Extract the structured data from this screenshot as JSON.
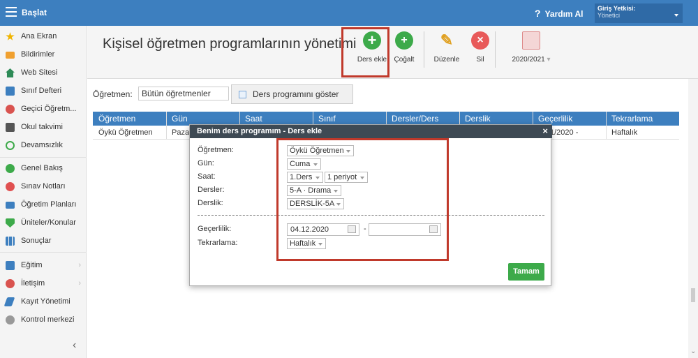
{
  "app": {
    "title": "Başlat"
  },
  "top": {
    "help_label": "Yardım Al",
    "help_icon": "question-icon",
    "login_label": "Giriş Yetkisi:",
    "login_role": "Yönetici"
  },
  "sidebar": {
    "items": [
      {
        "label": "Ana Ekran",
        "icon": "star-icon",
        "color": "#f0b400"
      },
      {
        "label": "Bildirimler",
        "icon": "envelope-icon",
        "color": "#f0a030"
      },
      {
        "label": "Web Sitesi",
        "icon": "home-icon",
        "color": "#2e8b57"
      },
      {
        "label": "Sınıf Defteri",
        "icon": "notebook-icon",
        "color": "#3d7fbf"
      },
      {
        "label": "Geçici Öğretm...",
        "icon": "person-icon",
        "color": "#d9534f"
      },
      {
        "label": "Okul takvimi",
        "icon": "calendar-icon",
        "color": "#555555"
      },
      {
        "label": "Devamsızlık",
        "icon": "user-outline-icon",
        "color": "#3daa4a"
      },
      {
        "label": "Genel Bakış",
        "icon": "check-circle-icon",
        "color": "#3daa4a"
      },
      {
        "label": "Sınav Notları",
        "icon": "grade-icon",
        "color": "#e05050"
      },
      {
        "label": "Öğretim Planları",
        "icon": "briefcase-icon",
        "color": "#3d7fbf"
      },
      {
        "label": "Üniteler/Konular",
        "icon": "shield-icon",
        "color": "#3daa4a"
      },
      {
        "label": "Sonuçlar",
        "icon": "bar-chart-icon",
        "color": "#3d7fbf"
      },
      {
        "label": "Eğitim",
        "icon": "school-icon",
        "color": "#3d7fbf"
      },
      {
        "label": "İletişim",
        "icon": "chat-icon",
        "color": "#d9534f"
      },
      {
        "label": "Kayıt Yönetimi",
        "icon": "pencil-icon",
        "color": "#3d7fbf"
      },
      {
        "label": "Kontrol merkezi",
        "icon": "gear-icon",
        "color": "#999999"
      }
    ],
    "collapse_glyph": "‹"
  },
  "header": {
    "title": "Kişisel öğretmen programlarının yönetimi",
    "toolbar": {
      "add_label": "Ders ekle",
      "copy_label": "Çoğalt",
      "edit_label": "Düzenle",
      "delete_label": "Sil",
      "year_label": "2020/2021"
    }
  },
  "filter": {
    "label": "Öğretmen:",
    "selected": "Bütün öğretmenler",
    "show_button": "Ders programını göster"
  },
  "table": {
    "headers": [
      "Öğretmen",
      "Gün",
      "Saat",
      "Sınıf",
      "Dersler/Ders",
      "Derslik",
      "Geçerlilik",
      "Tekrarlama"
    ],
    "rows": [
      {
        "teacher": "Öykü Öğretmen",
        "day": "Paza",
        "validity": "1/2020 -",
        "repeat": "Haftalık"
      }
    ]
  },
  "modal": {
    "title": "Benim ders programım - Ders ekle",
    "close": "×",
    "fields": {
      "teacher_label": "Öğretmen:",
      "teacher_value": "Öykü Öğretmen",
      "day_label": "Gün:",
      "day_value": "Cuma",
      "hour_label": "Saat:",
      "hour_value": "1.Ders",
      "period_value": "1 periyot",
      "lessons_label": "Dersler:",
      "lessons_value": "5-A · Drama",
      "room_label": "Derslik:",
      "room_value": "DERSLİK-5A",
      "validity_label": "Geçerlilik:",
      "validity_from": "04.12.2020",
      "validity_sep": "-",
      "validity_to": "",
      "repeat_label": "Tekrarlama:",
      "repeat_value": "Haftalık"
    },
    "ok_label": "Tamam"
  },
  "colors": {
    "topbar": "#3d7fbf",
    "add": "#3daa4a",
    "delete": "#e85a5a",
    "ok": "#3daa4a",
    "highlight": "#c0392b"
  }
}
